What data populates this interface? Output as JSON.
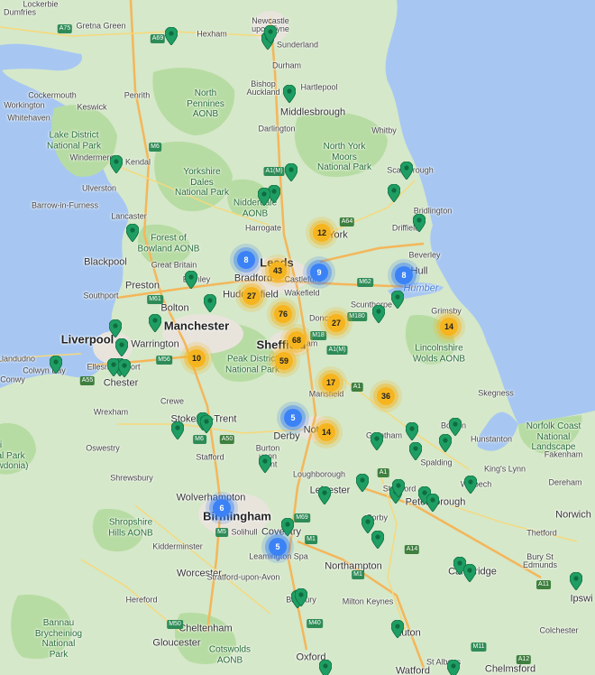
{
  "map": {
    "colors": {
      "sea": "#a7c7f2",
      "land": "#d5e8c9",
      "park": "#b7dca3",
      "urban": "#e8e4dc",
      "road": "#f7d87a",
      "motorway": "#f4b65a",
      "marker": "#1e9e63",
      "cluster_orange": "#f6b51e",
      "cluster_blue": "#3b82f6"
    },
    "labels": {
      "lockerbie": "Lockerbie",
      "dumfries": "Dumfries",
      "gretna": "Gretna Green",
      "newcastle": "Newcastle\nupon Tyne",
      "hexham": "Hexham",
      "sunderland": "Sunderland",
      "cockermouth": "Cockermouth",
      "penrith": "Penrith",
      "workington": "Workington",
      "whitehaven": "Whitehaven",
      "keswick": "Keswick",
      "northpennines": "North\nPennines\nAONB",
      "bishop": "Bishop\nAuckland",
      "durham": "Durham",
      "hartlepool": "Hartlepool",
      "middlesbrough": "Middlesbrough",
      "darlington": "Darlington",
      "whitby": "Whitby",
      "lakedistrict": "Lake District\nNational Park",
      "windermere": "Windermere",
      "kendal": "Kendal",
      "northyork": "North York\nMoors\nNational Park",
      "yorkshiredales": "Yorkshire\nDales\nNational Park",
      "scarborough": "Scarborough",
      "ulverston": "Ulverston",
      "barrow": "Barrow-in-Furness",
      "nidderdale": "Nidderdale\nAONB",
      "harrogate": "Harrogate",
      "bridlington": "Bridlington",
      "driffield": "Driffield",
      "lancaster": "Lancaster",
      "york": "York",
      "forestbowland": "Forest of\nBowland AONB",
      "blackpool": "Blackpool",
      "greatbritain": "Great Britain",
      "leeds": "Leeds",
      "beverley": "Beverley",
      "hull": "Hull",
      "humber": "Humber",
      "burnley": "Burnley",
      "bradford": "Bradford",
      "castleford": "Castleford",
      "preston": "Preston",
      "southport": "Southport",
      "huddersfield": "Huddersfield",
      "wakefield": "Wakefield",
      "bolton": "Bolton",
      "doncaster": "Donca",
      "scunthorpe": "Scunthorpe",
      "grimsby": "Grimsby",
      "manchester": "Manchester",
      "liverpool": "Liverpool",
      "warrington": "Warrington",
      "sheffield": "Sheffield",
      "rotherham": "am",
      "lincolnshire": "Lincolnshire\nWolds AONB",
      "llandudno": "Llandudno",
      "colwyn": "Colwyn Bay",
      "ellesmere": "Ellesmere Port",
      "chester": "Chester",
      "peakdistrict": "Peak District\nNational Park",
      "mansfield": "Mansfield",
      "skegness": "Skegness",
      "conwy": "Conwy",
      "crewe": "Crewe",
      "wrexham": "Wrexham",
      "stoke": "Stoke-on-Trent",
      "derby": "Derby",
      "nottingham": "Nottin",
      "grantham": "Grantham",
      "boston": "Boston",
      "hunstanton": "Hunstanton",
      "norfolkcoast": "Norfolk Coast\nNational\nLandscape",
      "fakenham": "Fakenham",
      "snowdonia": "ri\nal Park\nwdonia)",
      "oswestry": "Oswestry",
      "stafford": "Stafford",
      "burton": "Burton\nupon\nTrent",
      "loughborough": "Loughborough",
      "spalding": "Spalding",
      "kingslynn": "King's Lynn",
      "shrewsbury": "Shrewsbury",
      "wolverhampton": "Wolverhampton",
      "leicester": "Leicester",
      "stamford": "Stamford",
      "peterborough": "Peterborough",
      "wisbech": "Wisbech",
      "dereham": "Dereham",
      "norwich": "Norwich",
      "birmingham": "Birmingham",
      "corby": "Corby",
      "shropshire": "Shropshire\nHills AONB",
      "kidderminster": "Kidderminster",
      "solihull": "Solihull",
      "coventry": "Coventry",
      "thetford": "Thetford",
      "learnington": "Leamington Spa",
      "northampton": "Northampton",
      "burystedmunds": "Bury St\nEdmunds",
      "cambridge": "Cambridge",
      "worcester": "Worcester",
      "stratford": "Stratford-upon-Avon",
      "ipswich": "Ipswi",
      "hereford": "Hereford",
      "banbury": "Banbury",
      "miltonkeynes": "Milton Keynes",
      "colchester": "Colchester",
      "brecon": "Bannau\nBrycheiniog\nNational\nPark",
      "cheltenham": "Cheltenham",
      "luton": "Luton",
      "gloucester": "Gloucester",
      "cotswolds": "Cotswolds\nAONB",
      "oxford": "Oxford",
      "stalbans": "St Albans",
      "watford": "Watford",
      "chelmsford": "Chelmsford"
    },
    "roads": [
      "A75",
      "A69",
      "A1(M)",
      "M6",
      "A64",
      "M61",
      "M62",
      "M180",
      "A1(M)",
      "M18",
      "M56",
      "A55",
      "M6",
      "A50",
      "A1",
      "M69",
      "M5",
      "M1",
      "M40",
      "A14",
      "A11",
      "M11",
      "A12",
      "M50",
      "M1",
      "M6",
      "A1"
    ],
    "clusters": [
      {
        "count": "12",
        "color": "orange"
      },
      {
        "count": "8",
        "color": "blue"
      },
      {
        "count": "43",
        "color": "orange"
      },
      {
        "count": "9",
        "color": "blue"
      },
      {
        "count": "8",
        "color": "blue"
      },
      {
        "count": "27",
        "color": "orange"
      },
      {
        "count": "76",
        "color": "orange"
      },
      {
        "count": "27",
        "color": "orange"
      },
      {
        "count": "14",
        "color": "orange"
      },
      {
        "count": "68",
        "color": "orange"
      },
      {
        "count": "10",
        "color": "orange"
      },
      {
        "count": "59",
        "color": "orange"
      },
      {
        "count": "17",
        "color": "orange"
      },
      {
        "count": "36",
        "color": "orange"
      },
      {
        "count": "5",
        "color": "blue"
      },
      {
        "count": "14",
        "color": "orange"
      },
      {
        "count": "6",
        "color": "blue"
      },
      {
        "count": "5",
        "color": "blue"
      }
    ],
    "marker_count": 58
  }
}
